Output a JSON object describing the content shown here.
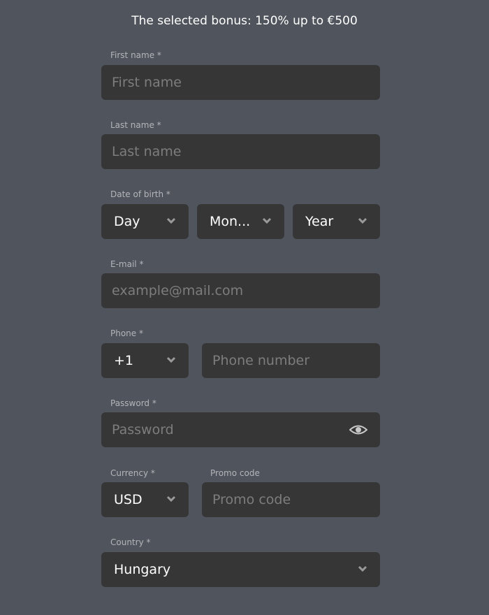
{
  "header": {
    "title": "The selected bonus: 150% up to €500"
  },
  "form": {
    "first_name": {
      "label": "First name *",
      "placeholder": "First name"
    },
    "last_name": {
      "label": "Last name *",
      "placeholder": "Last name"
    },
    "dob": {
      "label": "Date of birth *",
      "day": "Day",
      "month": "Mon...",
      "year": "Year"
    },
    "email": {
      "label": "E-mail *",
      "placeholder": "example@mail.com"
    },
    "phone": {
      "label": "Phone *",
      "code": "+1",
      "placeholder": "Phone number"
    },
    "password": {
      "label": "Password *",
      "placeholder": "Password",
      "icon": "eye-icon"
    },
    "currency": {
      "label": "Currency *",
      "value": "USD"
    },
    "promo": {
      "label": "Promo code",
      "placeholder": "Promo code"
    },
    "country": {
      "label": "Country *",
      "value": "Hungary"
    }
  },
  "colors": {
    "background": "#50545c",
    "field": "#363636",
    "label": "#b3b5ba",
    "placeholder": "#7d7d7d",
    "text": "#ffffff"
  }
}
